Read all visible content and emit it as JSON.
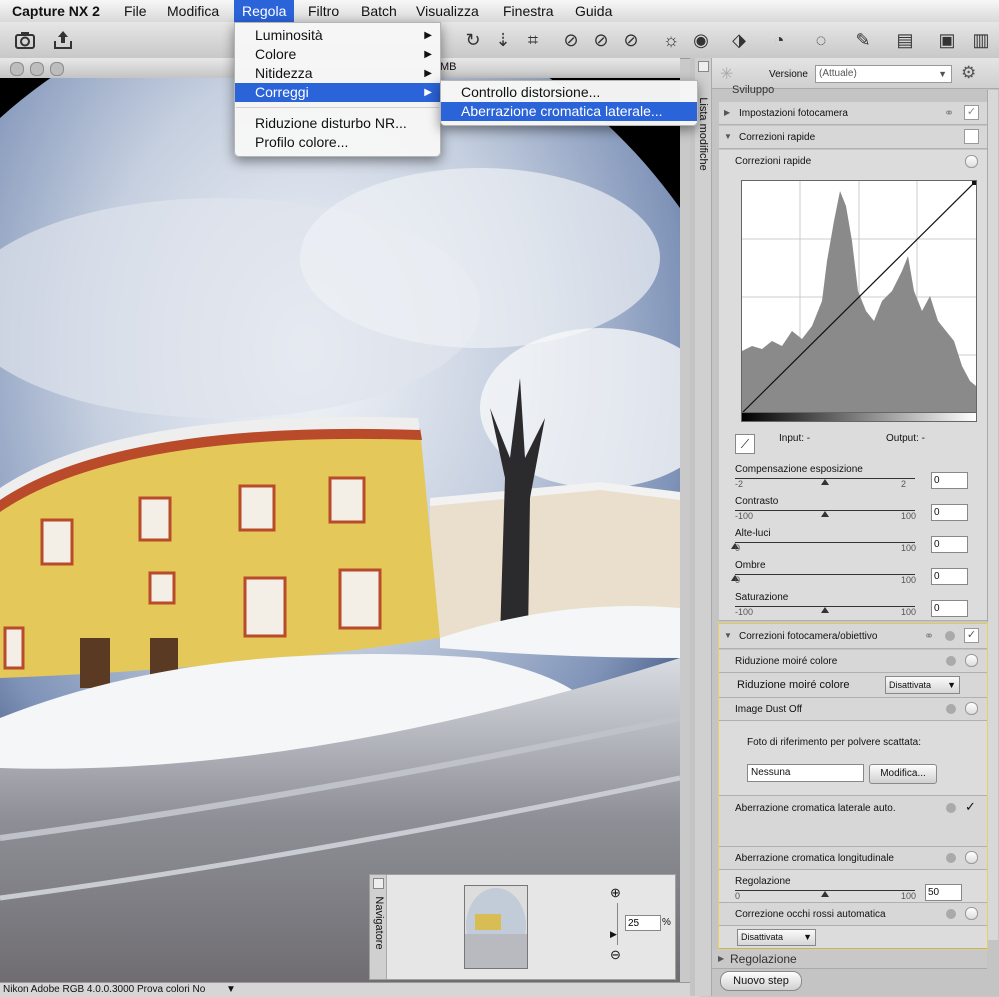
{
  "menubar": {
    "app": "Capture NX 2",
    "items": [
      "File",
      "Modifica",
      "Regola",
      "Filtro",
      "Batch",
      "Visualizza",
      "Finestra",
      "Guida"
    ]
  },
  "regola_menu": {
    "items": [
      "Luminosità",
      "Colore",
      "Nitidezza",
      "Correggi"
    ],
    "items2": [
      "Riduzione disturbo NR...",
      "Profilo colore..."
    ]
  },
  "correggi_menu": {
    "items": [
      "Controllo distorsione...",
      "Aberrazione cromatica laterale..."
    ]
  },
  "image_window": {
    "title_fragment": "MB"
  },
  "statusbar": {
    "text": "Nikon Adobe RGB 4.0.0.3000  Prova colori No"
  },
  "navigator": {
    "label": "Navigatore",
    "zoom": "25",
    "zoom_unit": "%"
  },
  "right_panel": {
    "tab_label": "Lista modifiche",
    "versione_label": "Versione",
    "versione_value": "(Attuale)",
    "sviluppo": "Sviluppo",
    "impostazioni": "Impostazioni fotocamera",
    "correzioni_rapide": "Correzioni rapide",
    "correzioni_rapide_sub": "Correzioni rapide",
    "input_label": "Input: -",
    "output_label": "Output: -",
    "sliders": [
      {
        "label": "Compensazione esposizione",
        "min": "-2",
        "max": "2",
        "value": "0",
        "frac": 0.5
      },
      {
        "label": "Contrasto",
        "min": "-100",
        "max": "100",
        "value": "0",
        "frac": 0.5
      },
      {
        "label": "Alte-luci",
        "min": "0",
        "max": "100",
        "value": "0",
        "frac": 0.0
      },
      {
        "label": "Ombre",
        "min": "0",
        "max": "100",
        "value": "0",
        "frac": 0.0
      },
      {
        "label": "Saturazione",
        "min": "-100",
        "max": "100",
        "value": "0",
        "frac": 0.5
      }
    ],
    "correzioni_fotocamera": "Correzioni fotocamera/obiettivo",
    "riduzione_moire": "Riduzione moiré colore",
    "riduzione_moire_label": "Riduzione moiré colore",
    "riduzione_moire_value": "Disattivata",
    "dust_off": "Image Dust Off",
    "dust_ref_label": "Foto di riferimento per polvere scattata:",
    "dust_ref_value": "Nessuna",
    "modifica_btn": "Modifica...",
    "aberr_lat": "Aberrazione cromatica laterale auto.",
    "aberr_lon": "Aberrazione cromatica longitudinale",
    "regolazione_label": "Regolazione",
    "regolazione_min": "0",
    "regolazione_max": "100",
    "regolazione_value": "50",
    "regolazione_frac": 0.5,
    "occhi_rossi": "Correzione occhi rossi automatica",
    "occhi_rossi_value": "Disattivata",
    "regolazione_section": "Regolazione",
    "nuovo_step": "Nuovo step"
  }
}
